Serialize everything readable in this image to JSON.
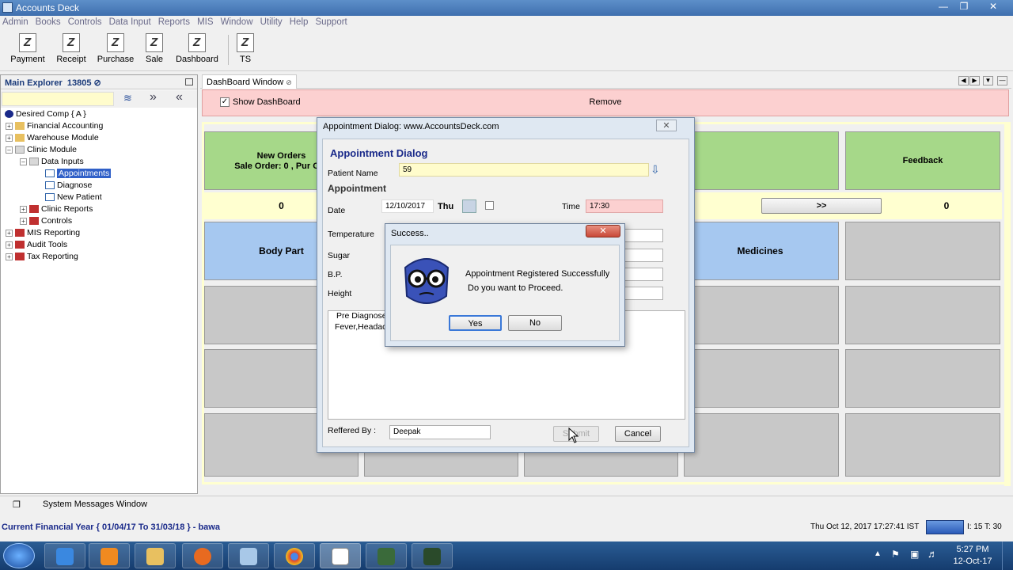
{
  "app": {
    "title": "Accounts Deck"
  },
  "menu": [
    "Admin",
    "Books",
    "Controls",
    "Data Input",
    "Reports",
    "MIS",
    "Window",
    "Utility",
    "Help",
    "Support"
  ],
  "toolbar": [
    {
      "label": "Payment",
      "icon": "payment-icon"
    },
    {
      "label": "Receipt",
      "icon": "receipt-icon"
    },
    {
      "label": "Purchase",
      "icon": "purchase-icon"
    },
    {
      "label": "Sale",
      "icon": "sale-icon"
    },
    {
      "label": "Dashboard",
      "icon": "dashboard-icon"
    },
    {
      "label": "TS",
      "icon": "ts-icon"
    }
  ],
  "explorer": {
    "title": "Main Explorer",
    "count": "13805",
    "tree": [
      {
        "label": "Desired Comp { A }"
      },
      {
        "label": "Financial Accounting"
      },
      {
        "label": "Warehouse Module"
      },
      {
        "label": "Clinic Module"
      },
      {
        "label": "Data Inputs"
      },
      {
        "label": "Appointments"
      },
      {
        "label": "Diagnose"
      },
      {
        "label": "New Patient"
      },
      {
        "label": "Clinic Reports"
      },
      {
        "label": "Controls"
      },
      {
        "label": "MIS Reporting"
      },
      {
        "label": "Audit Tools"
      },
      {
        "label": "Tax Reporting"
      }
    ]
  },
  "dashboard": {
    "tab": "DashBoard Window",
    "show_label": "Show DashBoard",
    "remove_label": "Remove",
    "new_orders": "New Orders",
    "sale_order": "Sale Order: 0 , Pur Ord",
    "feedback": "Feedback",
    "count_left": "0",
    "count_right": "0",
    "next_btn": ">>",
    "body_part": "Body Part",
    "medicines": "Medicines"
  },
  "appointment_dialog": {
    "window_title": "Appointment Dialog: www.AccountsDeck.com",
    "heading": "Appointment Dialog",
    "patient_label": "Patient Name",
    "patient_value": "59",
    "section": "Appointment",
    "date_label": "Date",
    "date_value": "12/10/2017",
    "day": "Thu",
    "time_label": "Time",
    "time_value": "17:30",
    "temperature_label": "Temperature",
    "sugar_label": "Sugar",
    "bp_label": "B.P.",
    "height_label": "Height",
    "prediag_label": "Pre Diagnose",
    "prediag_value": "Fever,Headac",
    "referred_label": "Reffered By :",
    "referred_value": "Deepak",
    "submit": "Submit",
    "cancel": "Cancel"
  },
  "success_dialog": {
    "title": "Success..",
    "line1": "Appointment Registered Successfully",
    "line2": "Do you want to Proceed.",
    "yes": "Yes",
    "no": "No"
  },
  "system_messages": "System Messages Window",
  "status": {
    "financial_year": "Current Financial Year { 01/04/17 To 31/03/18 } - bawa",
    "datetime": "Thu Oct 12, 2017 17:27:41 IST",
    "badge": "I: 15 T: 30"
  },
  "tray": {
    "time": "5:27 PM",
    "date": "12-Oct-17"
  }
}
